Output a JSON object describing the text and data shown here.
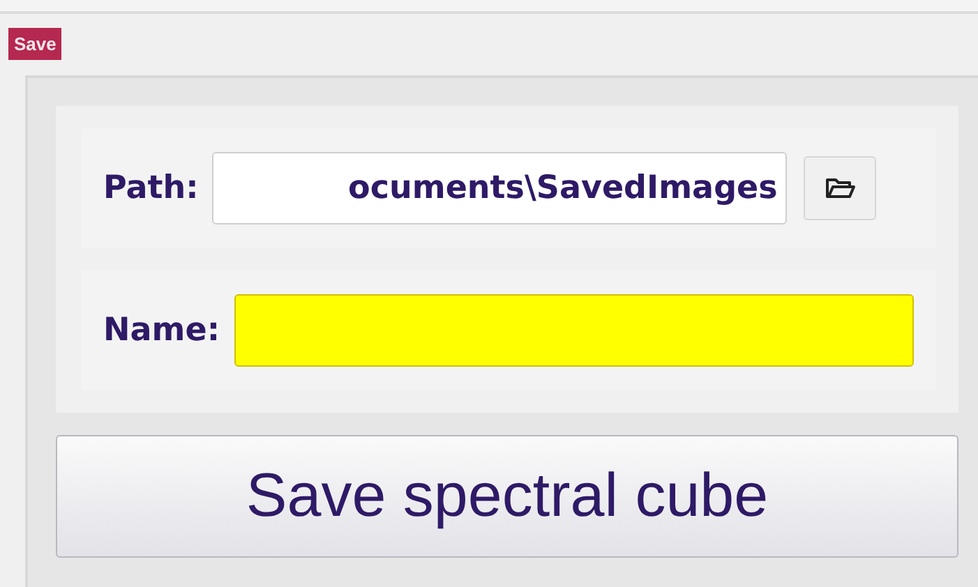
{
  "badge": "Save",
  "path": {
    "label": "Path:",
    "value": "ocuments\\SavedImages"
  },
  "name": {
    "label": "Name:",
    "highlighted": true
  },
  "save_button": "Save spectral cube"
}
